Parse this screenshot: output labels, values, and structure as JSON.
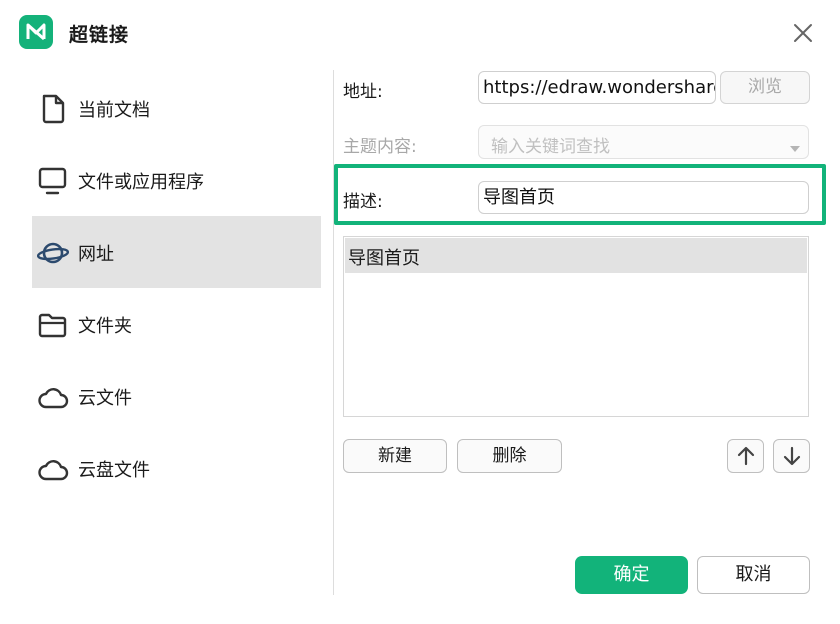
{
  "dialog": {
    "title": "超链接",
    "logo_icon": "mindmaster-logo-icon",
    "close_icon": "close-icon"
  },
  "sidebar": {
    "items": [
      {
        "label": "当前文档",
        "icon": "document-icon",
        "active": false
      },
      {
        "label": "文件或应用程序",
        "icon": "monitor-icon",
        "active": false
      },
      {
        "label": "网址",
        "icon": "planet-icon",
        "active": true
      },
      {
        "label": "文件夹",
        "icon": "folder-icon",
        "active": false
      },
      {
        "label": "云文件",
        "icon": "cloud-icon",
        "active": false
      },
      {
        "label": "云盘文件",
        "icon": "cloud-icon",
        "active": false
      }
    ]
  },
  "form": {
    "address_label": "地址:",
    "address_value": "https://edraw.wondershare",
    "browse_label": "浏览",
    "topic_label": "主题内容:",
    "topic_placeholder": "输入关键词查找",
    "description_label": "描述:",
    "description_value": "导图首页"
  },
  "list": {
    "items": [
      "导图首页"
    ]
  },
  "actions": {
    "new_label": "新建",
    "delete_label": "删除",
    "ok_label": "确定",
    "cancel_label": "取消"
  },
  "colors": {
    "accent": "#12b37a",
    "active_bg": "#e3e3e3"
  }
}
